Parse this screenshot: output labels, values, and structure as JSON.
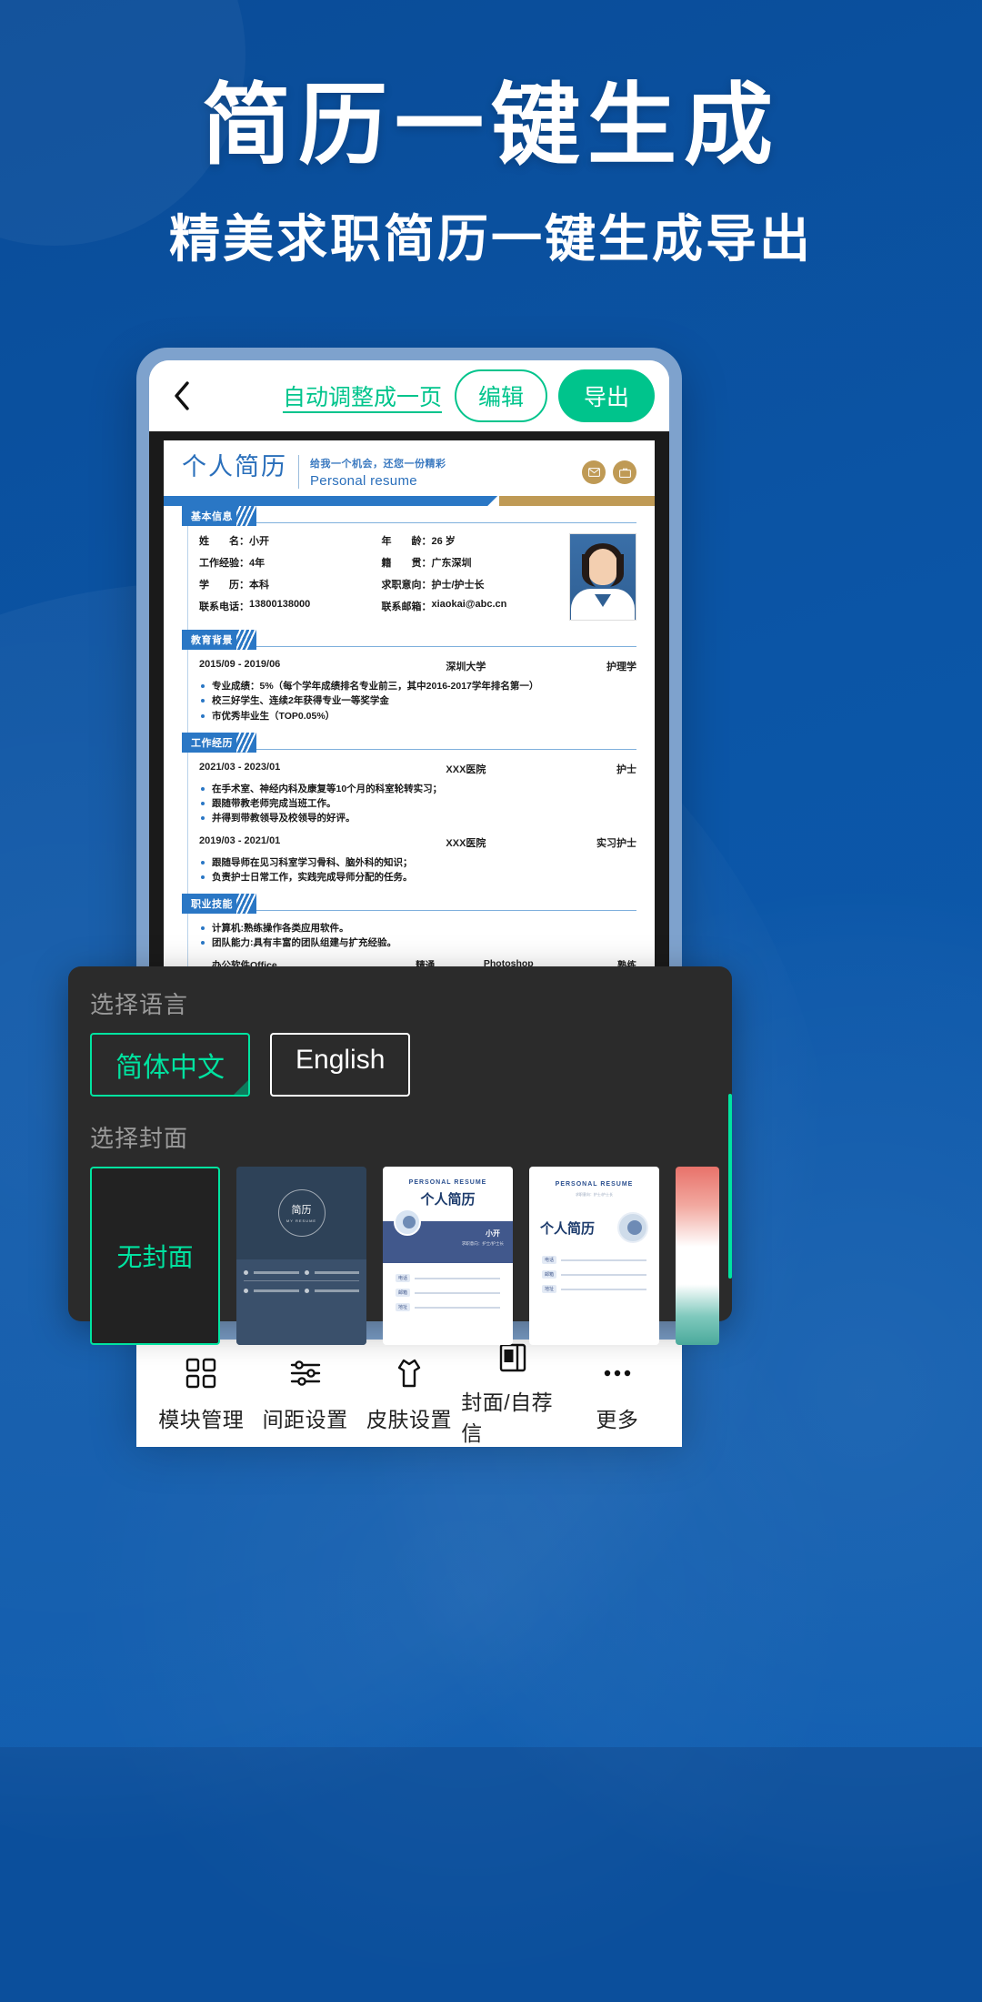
{
  "promo": {
    "title": "简历一键生成",
    "subtitle": "精美求职简历一键生成导出",
    "brand_blue": "#0b55a6",
    "accent_green": "#00c48c"
  },
  "toolbar": {
    "back_icon": "chevron-left-icon",
    "autofit_label": "自动调整成一页",
    "edit_label": "编辑",
    "export_label": "导出"
  },
  "resume": {
    "title_cn": "个人简历",
    "slogan_cn": "给我一个机会，还您一份精彩",
    "slogan_en": "Personal resume",
    "header_icons": [
      "mail-icon",
      "briefcase-icon"
    ],
    "sections": {
      "basic": {
        "tag": "基本信息",
        "fields": [
          {
            "key": "姓　　名：",
            "value": "小开"
          },
          {
            "key": "工作经验：",
            "value": "4年"
          },
          {
            "key": "学　　历：",
            "value": "本科"
          },
          {
            "key": "联系电话：",
            "value": "13800138000"
          },
          {
            "key": "年　　龄：",
            "value": "26 岁"
          },
          {
            "key": "籍　　贯：",
            "value": "广东深圳"
          },
          {
            "key": "求职意向：",
            "value": "护士/护士长"
          },
          {
            "key": "联系邮箱：",
            "value": "xiaokai@abc.cn"
          }
        ]
      },
      "education": {
        "tag": "教育背景",
        "entries": [
          {
            "date": "2015/09 - 2019/06",
            "org": "深圳大学",
            "role": "护理学",
            "bullets": [
              "专业成绩：5%（每个学年成绩排名专业前三，其中2016-2017学年排名第一）",
              "校三好学生、连续2年获得专业一等奖学金",
              "市优秀毕业生（TOP0.05%）"
            ]
          }
        ]
      },
      "work": {
        "tag": "工作经历",
        "entries": [
          {
            "date": "2021/03 - 2023/01",
            "org": "XXX医院",
            "role": "护士",
            "bullets": [
              "在手术室、神经内科及康复等10个月的科室轮转实习；",
              "跟随带教老师完成当班工作。",
              "并得到带教领导及校领导的好评。"
            ]
          },
          {
            "date": "2019/03 - 2021/01",
            "org": "XXX医院",
            "role": "实习护士",
            "bullets": [
              "跟随导师在见习科室学习骨科、脑外科的知识；",
              "负责护士日常工作，实践完成导师分配的任务。"
            ]
          }
        ]
      },
      "skills": {
        "tag": "职业技能",
        "bullets": [
          "计算机:熟练操作各类应用软件。",
          "团队能力:具有丰富的团队组建与扩充经验。"
        ],
        "rated": [
          {
            "name": "办公软件Office",
            "level": "精通",
            "name2": "Photoshop",
            "level2": "熟练"
          }
        ]
      }
    }
  },
  "sheet": {
    "language_label": "选择语言",
    "languages": [
      {
        "label": "简体中文",
        "selected": true
      },
      {
        "label": "English",
        "selected": false
      }
    ],
    "cover_label": "选择封面",
    "covers": [
      {
        "id": "none",
        "label": "无封面",
        "selected": true
      },
      {
        "id": "navy",
        "title_cn": "简历",
        "title_en": "MY RESUME",
        "selected": false
      },
      {
        "id": "blue-band",
        "title_en": "PERSONAL RESUME",
        "title_cn": "个人简历",
        "name": "小开",
        "sub": "求职意向：护士/护士长",
        "selected": false
      },
      {
        "id": "photo-right",
        "title_en": "PERSONAL RESUME",
        "title_cn": "个人简历",
        "tiny": "求职意向：护士/护士长",
        "selected": false
      },
      {
        "id": "watercolor",
        "selected": false
      }
    ]
  },
  "bottom_nav": [
    {
      "icon": "grid-icon",
      "label": "模块管理"
    },
    {
      "icon": "sliders-icon",
      "label": "间距设置"
    },
    {
      "icon": "shirt-icon",
      "label": "皮肤设置"
    },
    {
      "icon": "book-cover-icon",
      "label": "封面/自荐信"
    },
    {
      "icon": "ellipsis-icon",
      "label": "更多"
    }
  ]
}
